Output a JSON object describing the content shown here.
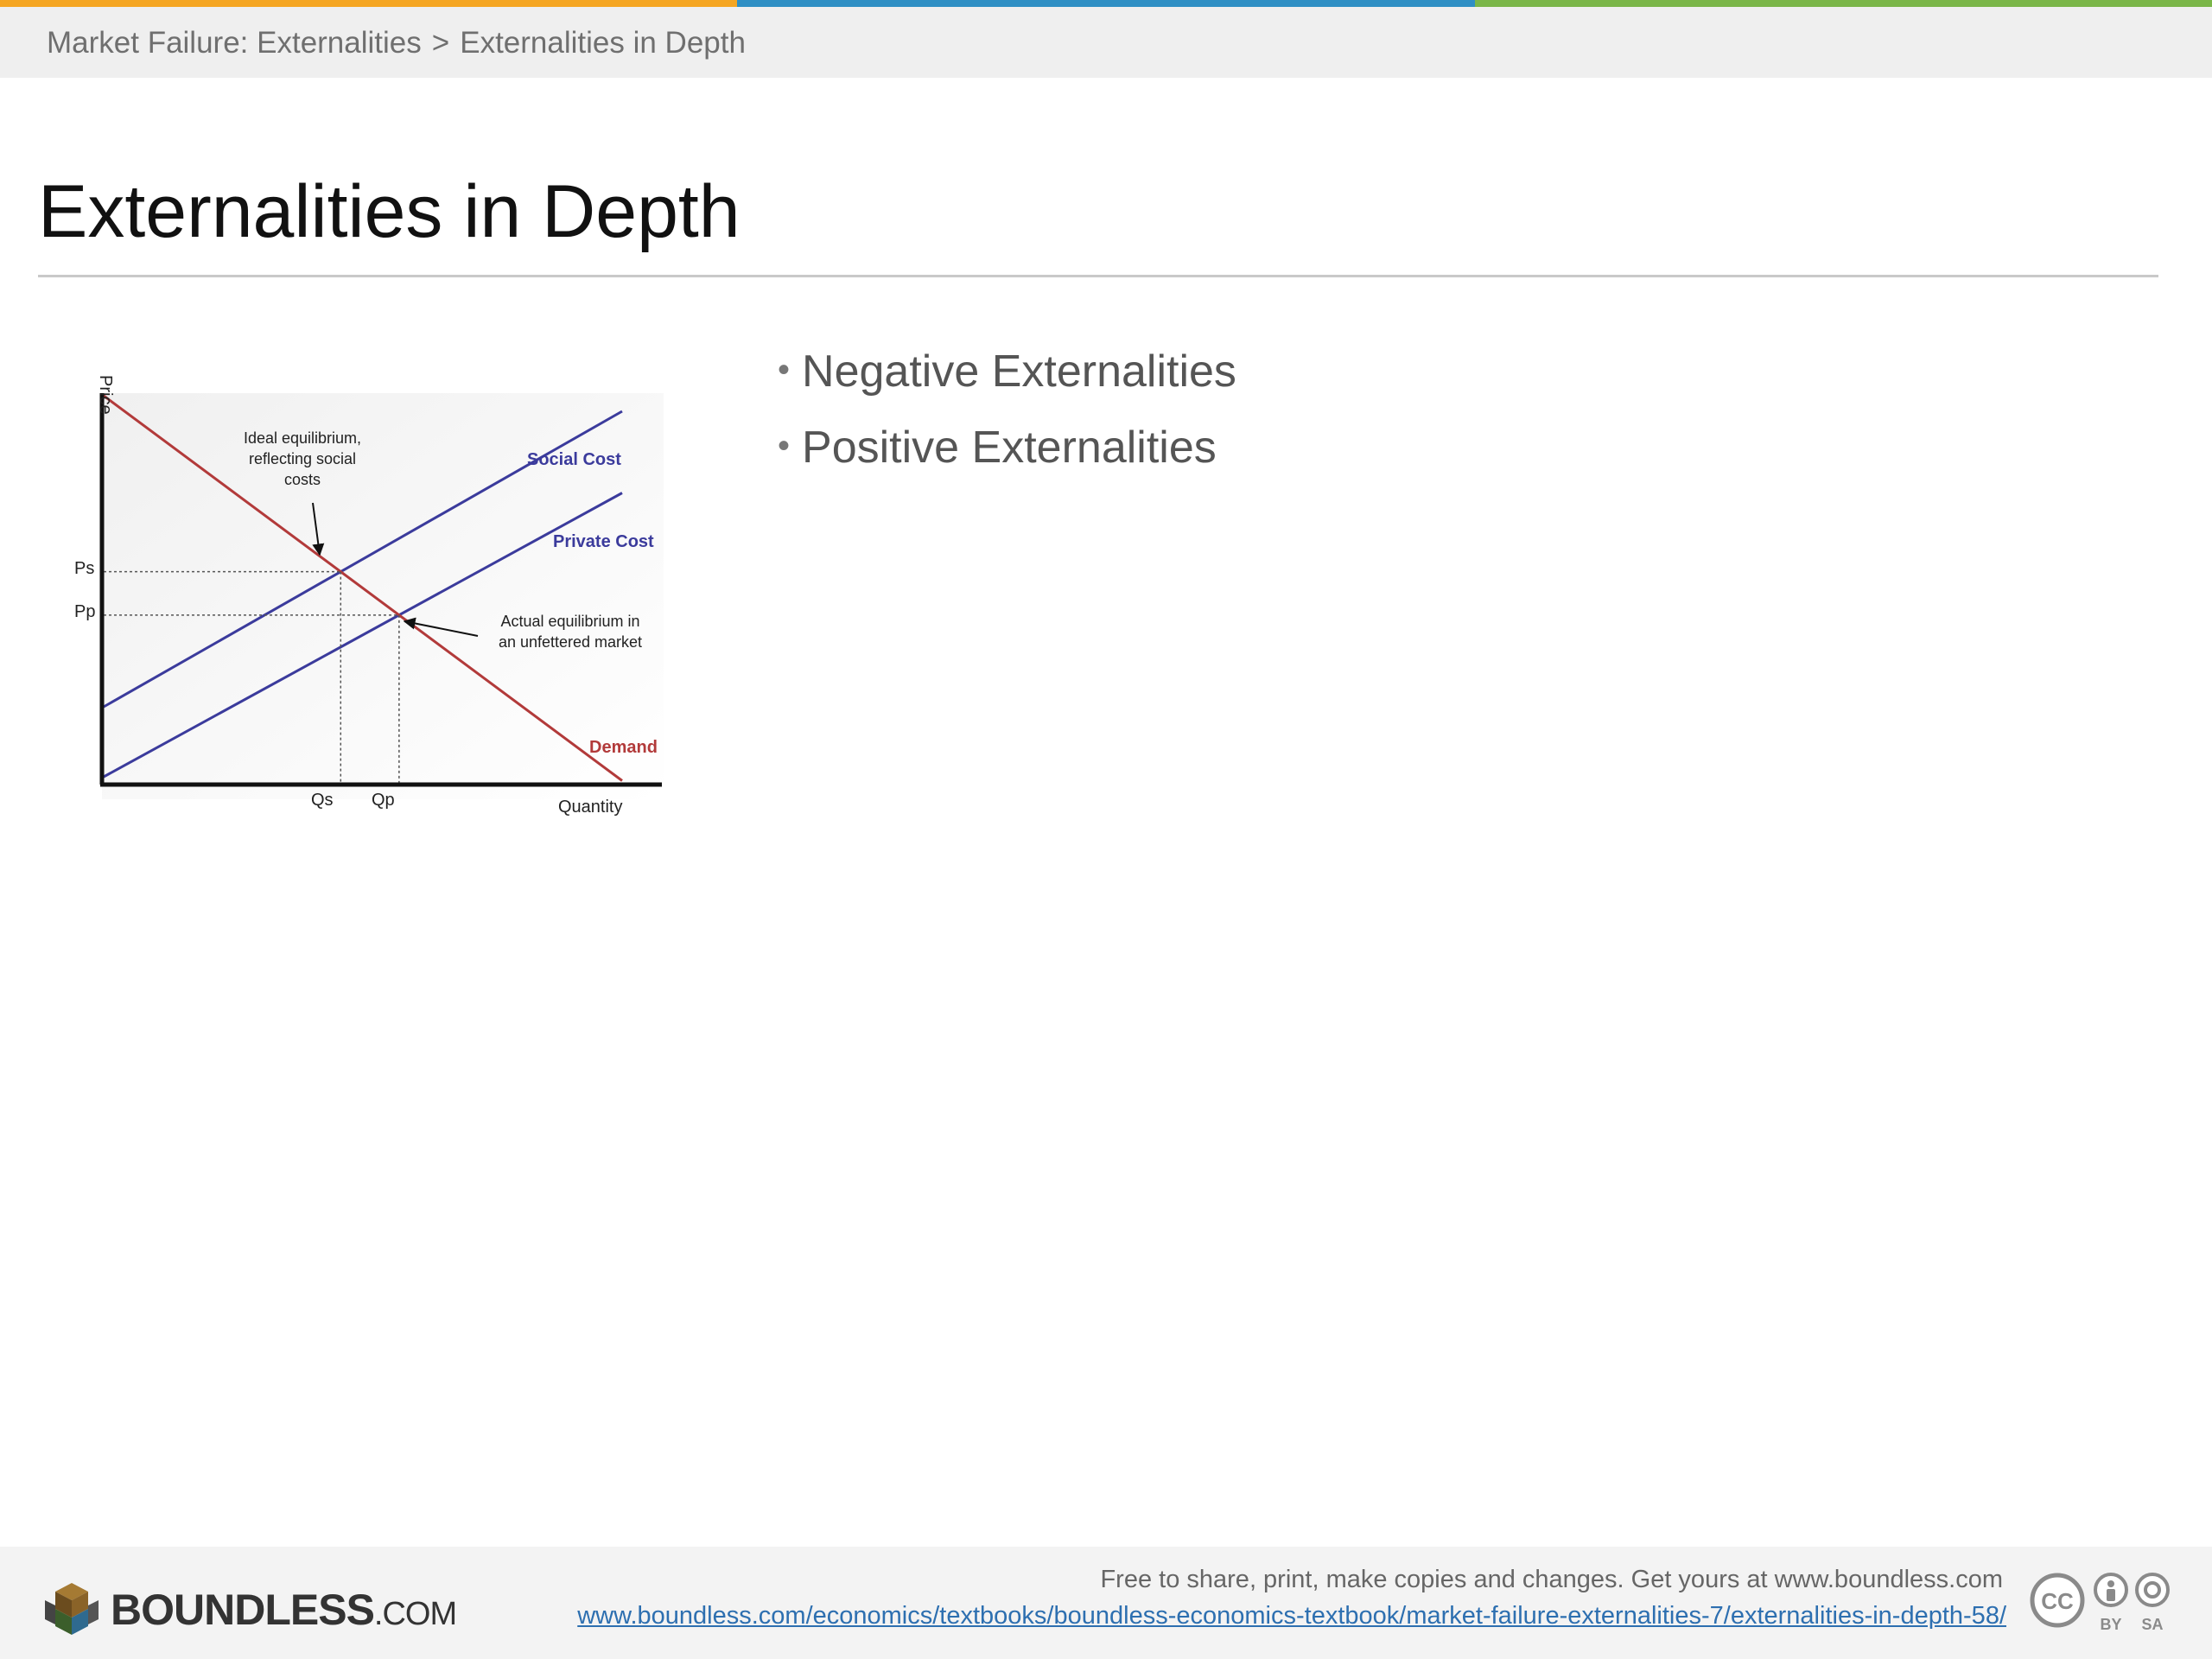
{
  "colors": {
    "top_bar": [
      "#f5a623",
      "#2f8fc4",
      "#7ab648"
    ],
    "social_cost_line": "#3b3b9c",
    "private_cost_line": "#3b3b9c",
    "demand_line": "#b23a3a"
  },
  "breadcrumb": {
    "parent": "Market Failure: Externalities",
    "separator": ">",
    "current": "Externalities in Depth"
  },
  "slide": {
    "title": "Externalities in Depth",
    "bullets": [
      "Negative Externalities",
      "Positive Externalities"
    ]
  },
  "chart_data": {
    "type": "line",
    "ylabel": "Price",
    "xlabel": "Quantity",
    "y_ticks": [
      "Ps",
      "Pp"
    ],
    "x_ticks": [
      "Qs",
      "Qp"
    ],
    "series": [
      {
        "name": "Social Cost",
        "points": [
          [
            0,
            20
          ],
          [
            100,
            96
          ]
        ]
      },
      {
        "name": "Private Cost",
        "points": [
          [
            0,
            2
          ],
          [
            100,
            75
          ]
        ]
      },
      {
        "name": "Demand",
        "points": [
          [
            0,
            100
          ],
          [
            100,
            1
          ]
        ]
      }
    ],
    "equilibria": {
      "ideal": {
        "q_label": "Qs",
        "p_label": "Ps"
      },
      "actual": {
        "q_label": "Qp",
        "p_label": "Pp"
      }
    },
    "annotations": [
      "Ideal equilibrium, reflecting social costs",
      "Actual equilibrium in an unfettered market"
    ]
  },
  "footer": {
    "brand": "BOUNDLESS",
    "brand_suffix": ".COM",
    "share_text": "Free to share, print, make copies and changes. Get yours at www.boundless.com",
    "url": "www.boundless.com/economics/textbooks/boundless-economics-textbook/market-failure-externalities-7/externalities-in-depth-58/",
    "license": {
      "cc": "CC",
      "by": "BY",
      "sa": "SA"
    }
  }
}
